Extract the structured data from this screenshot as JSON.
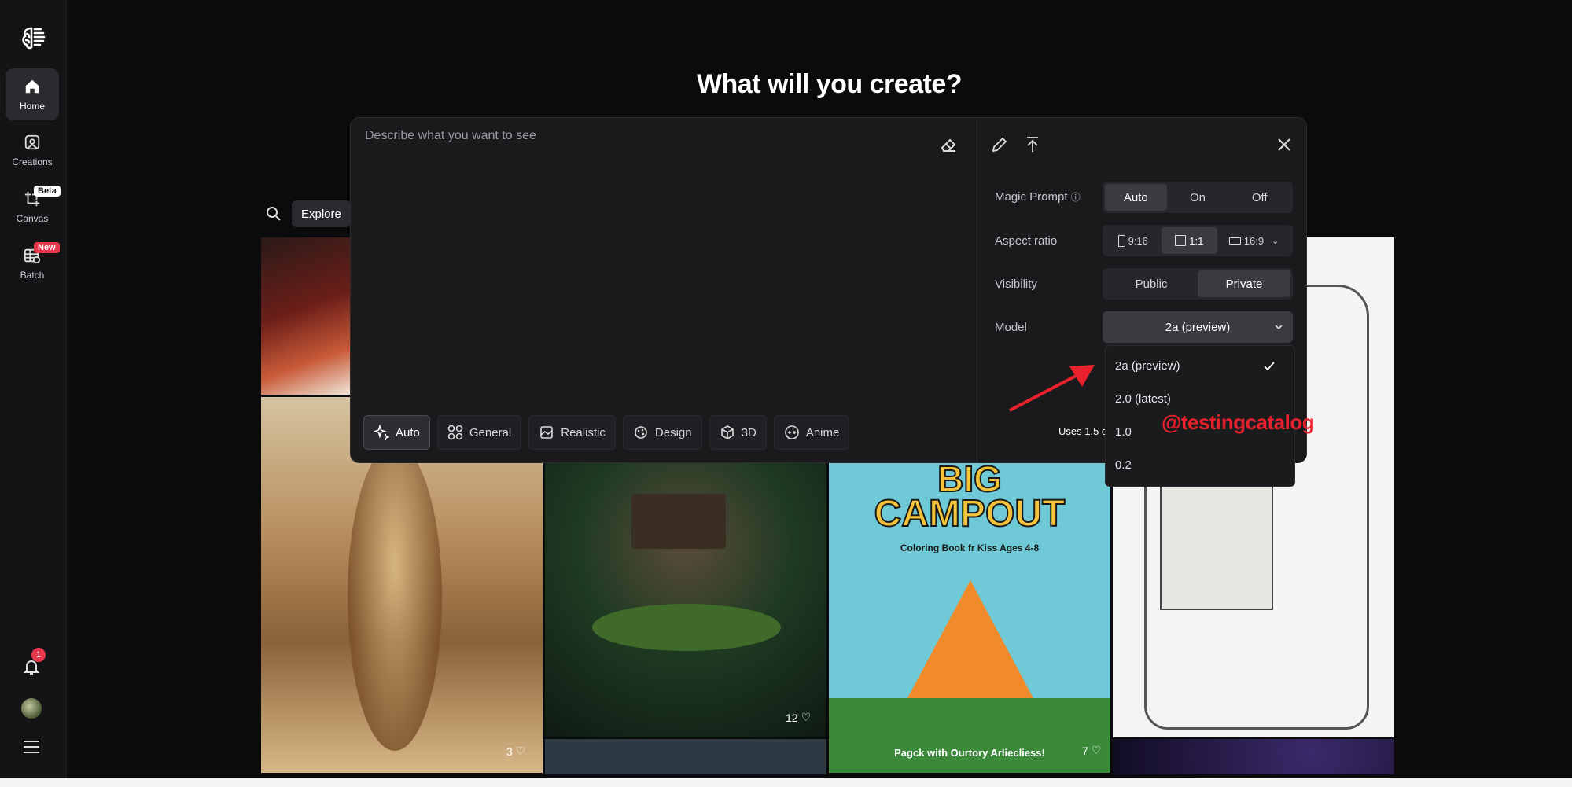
{
  "sidebar": {
    "items": [
      {
        "label": "Home",
        "icon": "home-icon"
      },
      {
        "label": "Creations",
        "icon": "creations-icon"
      },
      {
        "label": "Canvas",
        "icon": "canvas-icon",
        "badge": "Beta"
      },
      {
        "label": "Batch",
        "icon": "batch-icon",
        "badge": "New"
      }
    ],
    "notification_count": "1"
  },
  "headline": "What will you create?",
  "explore": {
    "label": "Explore"
  },
  "prompt": {
    "placeholder": "Describe what you want to see",
    "styles": [
      "Auto",
      "General",
      "Realistic",
      "Design",
      "3D",
      "Anime"
    ]
  },
  "settings": {
    "magic_prompt": {
      "label": "Magic Prompt",
      "options": [
        "Auto",
        "On",
        "Off"
      ],
      "selected": "Auto"
    },
    "aspect_ratio": {
      "label": "Aspect ratio",
      "options": [
        "9:16",
        "1:1",
        "16:9"
      ],
      "selected": "1:1"
    },
    "visibility": {
      "label": "Visibility",
      "options": [
        "Public",
        "Private"
      ],
      "selected": "Private"
    },
    "model": {
      "label": "Model",
      "value": "2a (preview)",
      "options": [
        "2a (preview)",
        "2.0 (latest)",
        "1.0",
        "0.2"
      ]
    },
    "uses_text": "Uses 1.5 c"
  },
  "gallery": {
    "likes": [
      "3",
      "12",
      "7"
    ],
    "poster_title_1": "BIG",
    "poster_title_2": "CAMPOUT",
    "poster_subtitle": "Coloring Book fr Kiss Ages 4-8",
    "poster_footer": "Pagck with Ourtory Arliecliess!"
  },
  "watermark": "@testingcatalog",
  "colors": {
    "accent_red": "#e8212c",
    "badge_red": "#e8364c",
    "panel": "#1a1a1d"
  }
}
